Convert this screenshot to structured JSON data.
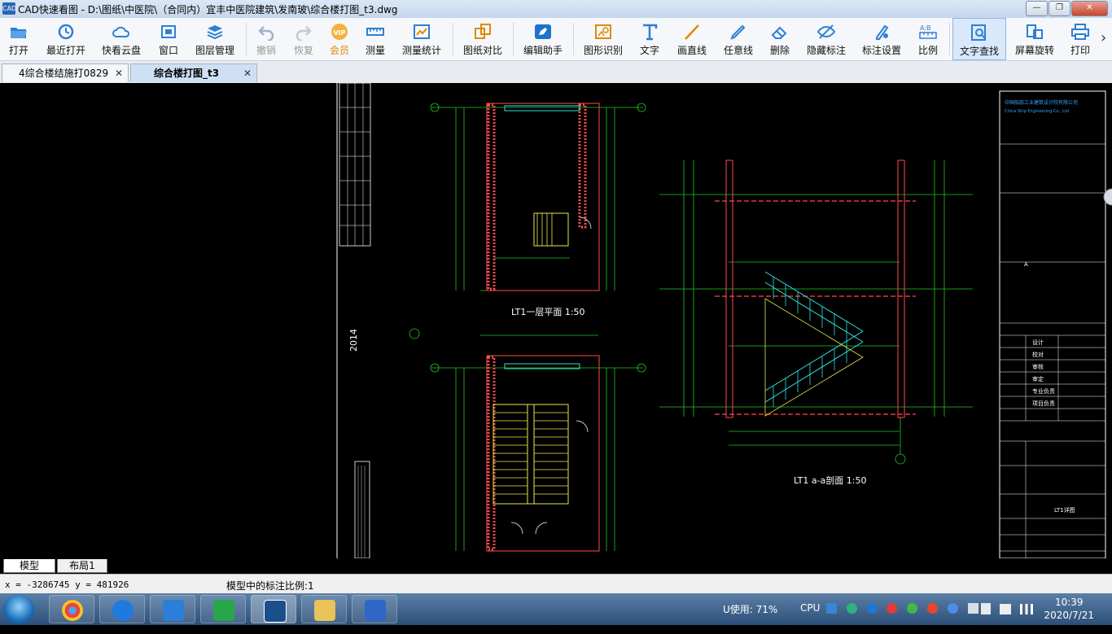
{
  "window": {
    "app_icon": "CAD",
    "title": "CAD快速看图 - D:\\图纸\\中医院\\（合同内）宜丰中医院建筑\\发南玻\\综合楼打图_t3.dwg",
    "minimize": "—",
    "maximize": "❐",
    "close": "✕"
  },
  "toolbar": {
    "items": [
      {
        "label": "打开",
        "icon": "folder-open-icon"
      },
      {
        "label": "最近打开",
        "icon": "recent-clock-icon"
      },
      {
        "label": "快看云盘",
        "icon": "cloud-icon"
      },
      {
        "label": "窗口",
        "icon": "window-icon"
      },
      {
        "label": "图层管理",
        "icon": "layers-icon"
      },
      {
        "label": "撤销",
        "icon": "undo-icon"
      },
      {
        "label": "恢复",
        "icon": "redo-icon"
      },
      {
        "label": "会员",
        "icon": "vip-icon"
      },
      {
        "label": "测量",
        "icon": "ruler-icon"
      },
      {
        "label": "测量统计",
        "icon": "measure-stats-icon"
      },
      {
        "label": "图纸对比",
        "icon": "compare-icon"
      },
      {
        "label": "编辑助手",
        "icon": "edit-assistant-icon"
      },
      {
        "label": "图形识别",
        "icon": "shape-recognize-icon"
      },
      {
        "label": "文字",
        "icon": "text-t-icon"
      },
      {
        "label": "画直线",
        "icon": "line-icon"
      },
      {
        "label": "任意线",
        "icon": "pen-icon"
      },
      {
        "label": "删除",
        "icon": "eraser-icon"
      },
      {
        "label": "隐藏标注",
        "icon": "eye-hide-icon"
      },
      {
        "label": "标注设置",
        "icon": "annotation-settings-icon"
      },
      {
        "label": "比例",
        "icon": "scale-icon"
      },
      {
        "label": "文字查找",
        "icon": "text-search-icon"
      },
      {
        "label": "屏幕旋转",
        "icon": "rotate-screen-icon"
      },
      {
        "label": "打印",
        "icon": "printer-icon"
      }
    ],
    "more": "›",
    "vip_text": "VIP"
  },
  "tabs": [
    {
      "label": "4综合楼结施打0829",
      "close": "✕"
    },
    {
      "label": "综合楼打图_t3",
      "close": "✕"
    }
  ],
  "drawing": {
    "plan1_title": "LT1一层平面 1:50",
    "section_title": "LT1 a-a剖面 1:50",
    "year": "2014",
    "axis_label": "t1",
    "company": "中国船舶工业建筑设计院有限公司",
    "company_en": "China Ship Engineering Co., Ltd.",
    "drawing_no_title": "LT1详图",
    "axis_a": "A",
    "row_labels": [
      "设计",
      "校对",
      "审核",
      "审定",
      "专业负责",
      "项目负责"
    ]
  },
  "layout_tabs": [
    "模型",
    "布局1"
  ],
  "status": {
    "coords": "x = -3286745  y = 481926",
    "scale_text": "模型中的标注比例:1"
  },
  "taskbar": {
    "tray_usage": "U使用: 71%",
    "cpu": "CPU",
    "time": "10:39",
    "date": "2020/7/21",
    "apps": [
      "chrome-icon",
      "feishu-icon",
      "typora-icon",
      "h-app-icon",
      "cad-icon",
      "explorer-icon",
      "wps-icon"
    ]
  },
  "colors": {
    "drawing_bg": "#000000",
    "wall": "#ff4a4a",
    "stairs": "#e8e84a",
    "dimension": "#21c821",
    "rail": "#33e0e0",
    "frame": "#ffffff"
  }
}
